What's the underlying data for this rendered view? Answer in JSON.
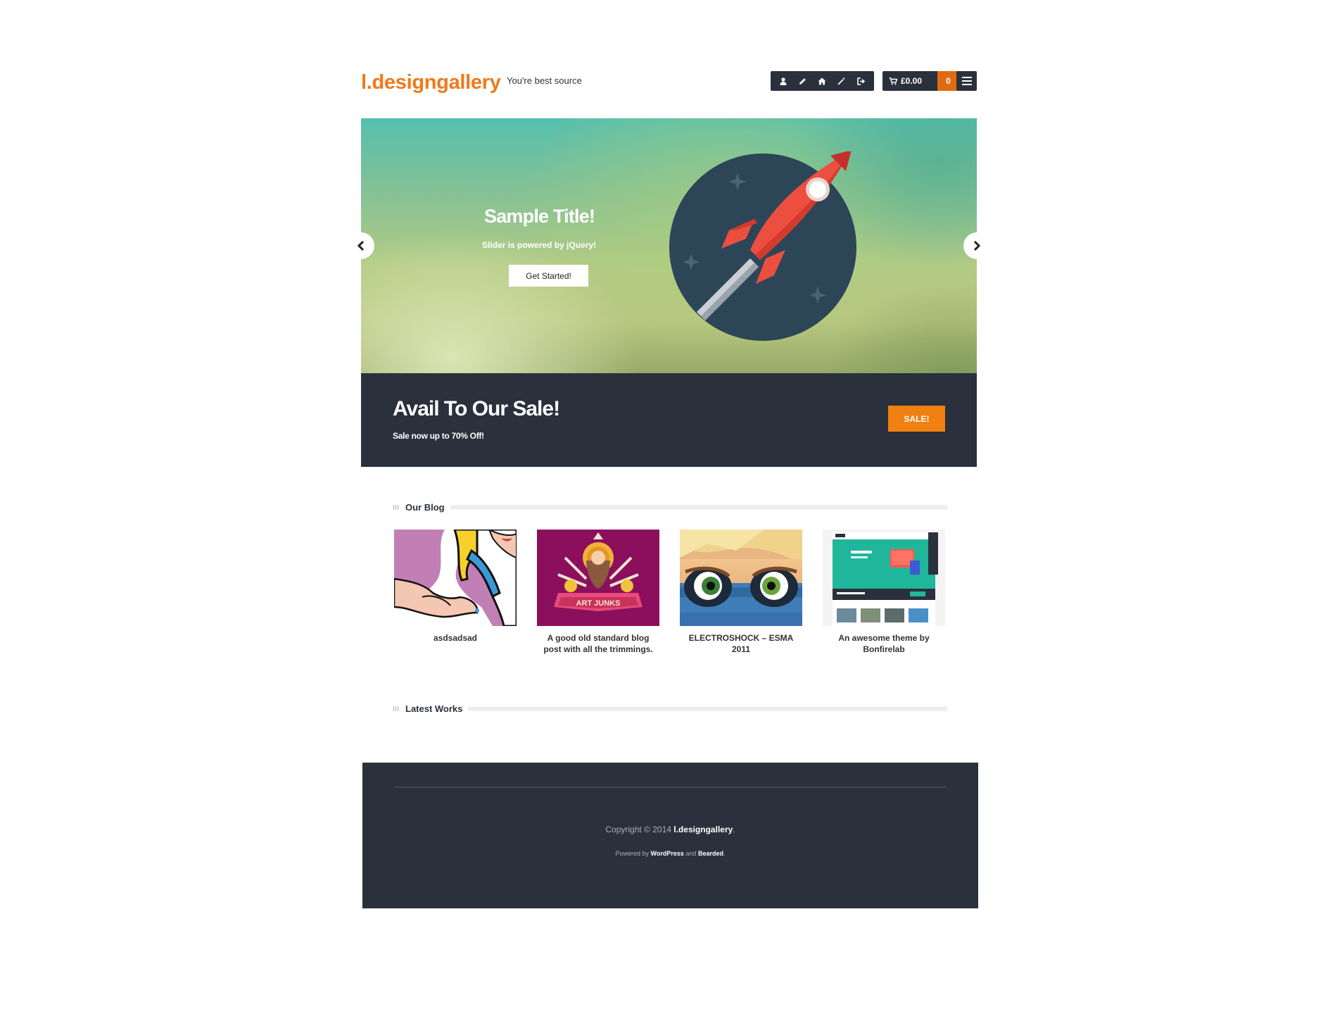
{
  "header": {
    "logo": "l.designgallery",
    "tagline": "You're best source",
    "icons": [
      "user-icon",
      "pencil-icon",
      "home-icon",
      "magic-wand-icon",
      "logout-icon"
    ],
    "cart_amount": "£0.00",
    "cart_count": "0",
    "menu_icon": "hamburger-icon"
  },
  "slider": {
    "title": "Sample Title!",
    "subtitle": "Slider is powered by jQuery!",
    "button": "Get Started!",
    "image": "rocket-illustration"
  },
  "sale": {
    "title": "Avail To Our Sale!",
    "subtitle": "Sale now up to 70% Off!",
    "button": "SALE!"
  },
  "blog": {
    "heading": "Our Blog",
    "posts": [
      {
        "title": "asdsadsad",
        "image": "pop-art-hands"
      },
      {
        "title": "A good old standard blog post with all the trimmings.",
        "image": "art-junks-poster"
      },
      {
        "title": "ELECTROSHOCK – ESMA 2011",
        "image": "cartoon-character-goggles"
      },
      {
        "title": "An awesome theme by Bonfirelab",
        "image": "theme-screenshot"
      }
    ]
  },
  "works": {
    "heading": "Latest Works"
  },
  "footer": {
    "copyright_prefix": "Copyright © 2014",
    "copyright_brand": "l.designgallery",
    "copyright_suffix": ".",
    "powered_prefix": "Powered by",
    "powered_link1": "WordPress",
    "powered_and": "and",
    "powered_link2": "Bearded",
    "powered_suffix": "."
  },
  "colors": {
    "brand_orange": "#ef7a1a",
    "dark_navy": "#2a313c",
    "sale_orange": "#f08010",
    "cart_orange": "#e06a10"
  }
}
